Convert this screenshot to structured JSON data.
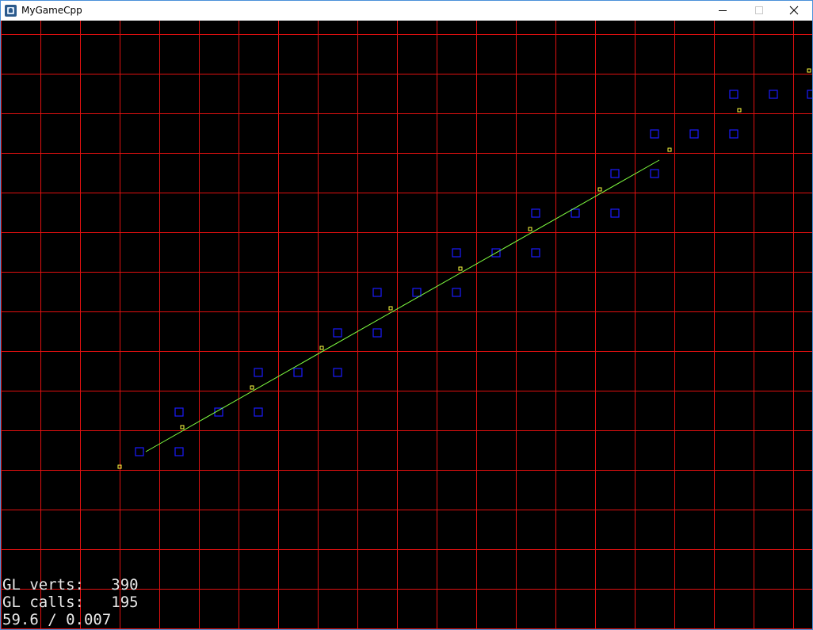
{
  "window": {
    "title": "MyGameCpp",
    "icon": "app-icon",
    "controls": [
      "minimize-icon",
      "maximize-icon",
      "close-icon"
    ]
  },
  "scene": {
    "grid_color": "#e01010",
    "tile_color": "#1a1aff",
    "point_color": "#ffff40",
    "line_color": "#80ff40",
    "background": "#000000"
  },
  "hud": {
    "verts_line": "GL verts:   390",
    "calls_line": "GL calls:   195",
    "fps_line": "59.6 / 0.007"
  }
}
